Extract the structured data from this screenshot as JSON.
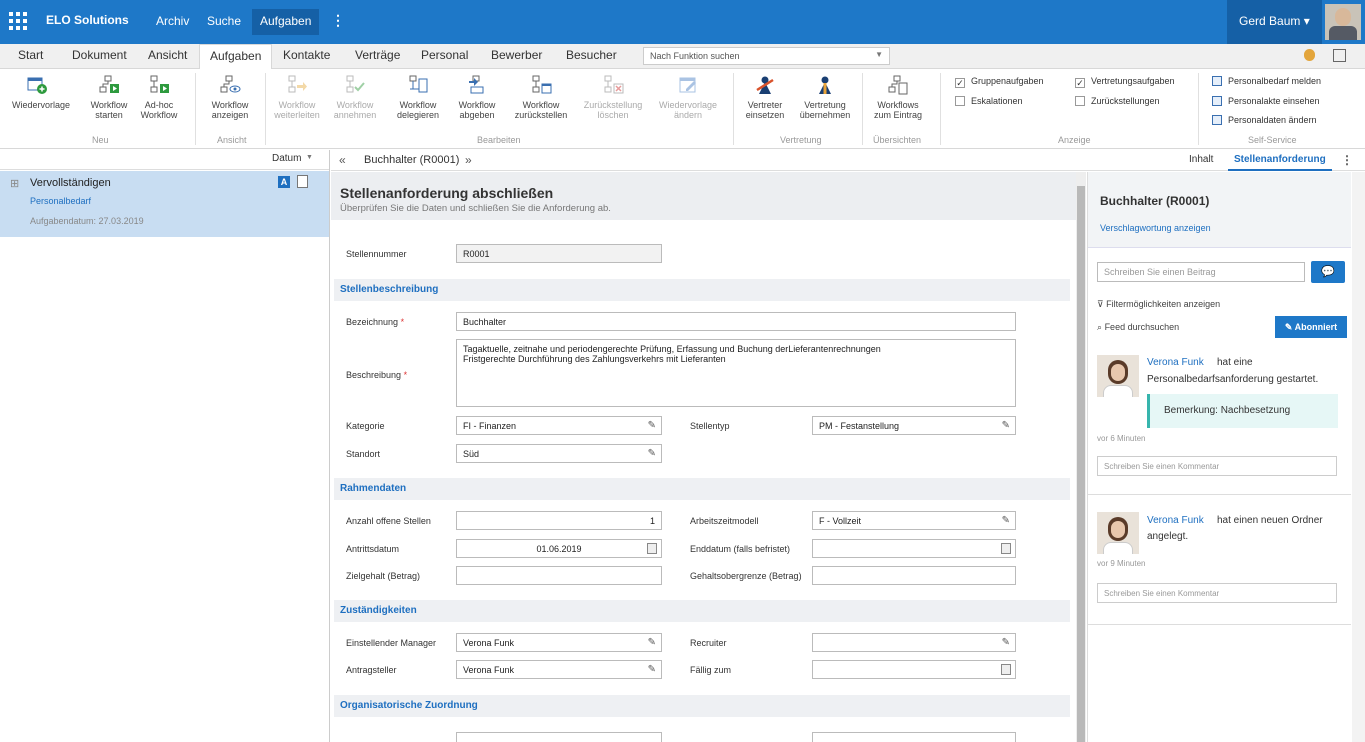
{
  "topbar": {
    "brand": "ELO Solutions",
    "nav": [
      "Archiv",
      "Suche",
      "Aufgaben"
    ],
    "more": "⋮",
    "user": "Gerd Baum ▾"
  },
  "ribbon_tabs": [
    "Start",
    "Dokument",
    "Ansicht",
    "Aufgaben",
    "Kontakte",
    "Verträge",
    "Personal",
    "Bewerber",
    "Besucher"
  ],
  "function_search_placeholder": "Nach Funktion suchen",
  "ribbon": {
    "buttons": [
      {
        "label": "Wiedervorlage",
        "icon": "wiedervorlage-icon"
      },
      {
        "label": "Workflow\nstarten",
        "icon": "workflow-start-icon"
      },
      {
        "label": "Ad-hoc\nWorkflow",
        "icon": "adhoc-workflow-icon"
      },
      {
        "label": "Workflow\nanzeigen",
        "icon": "workflow-view-icon"
      },
      {
        "label": "Workflow\nweiterleiten",
        "icon": "workflow-forward-icon"
      },
      {
        "label": "Workflow\nannehmen",
        "icon": "workflow-accept-icon"
      },
      {
        "label": "Workflow\ndelegieren",
        "icon": "workflow-delegate-icon"
      },
      {
        "label": "Workflow\nabgeben",
        "icon": "workflow-handover-icon"
      },
      {
        "label": "Workflow\nzurückstellen",
        "icon": "workflow-defer-icon"
      },
      {
        "label": "Zurückstellung\nlöschen",
        "icon": "delete-deferral-icon"
      },
      {
        "label": "Wiedervorlage\nändern",
        "icon": "edit-resubmission-icon"
      },
      {
        "label": "Vertreter\neinsetzen",
        "icon": "assign-substitute-icon"
      },
      {
        "label": "Vertretung\nübernehmen",
        "icon": "take-substitution-icon"
      },
      {
        "label": "Workflows\nzum Eintrag",
        "icon": "workflows-entry-icon"
      }
    ],
    "groups": [
      "Neu",
      "Ansicht",
      "Bearbeiten",
      "Vertretung",
      "Übersichten",
      "Anzeige",
      "Self-Service"
    ],
    "checkboxes": [
      {
        "label": "Gruppenaufgaben",
        "checked": true
      },
      {
        "label": "Eskalationen",
        "checked": false
      },
      {
        "label": "Vertretungsaufgaben",
        "checked": true
      },
      {
        "label": "Zurückstellungen",
        "checked": false
      }
    ],
    "self_service": [
      "Personalbedarf melden",
      "Personalakte einsehen",
      "Personaldaten ändern"
    ]
  },
  "left": {
    "sort_label": "Datum",
    "task_title": "Vervollständigen",
    "task_sub": "Personalbedarf",
    "task_date": "Aufgabendatum: 27.03.2019",
    "badge": "A"
  },
  "breadcrumb": {
    "back": "«",
    "title": "Buchhalter (R0001)",
    "forward": "»"
  },
  "view_tabs": [
    "Inhalt",
    "Stellenanforderung"
  ],
  "form": {
    "title": "Stellenanforderung abschließen",
    "subtitle": "Überprüfen Sie die Daten und schließen Sie die Anforderung ab.",
    "stellennummer_label": "Stellennummer",
    "stellennummer": "R0001",
    "sections": [
      "Stellenbeschreibung",
      "Rahmendaten",
      "Zuständigkeiten",
      "Organisatorische Zuordnung"
    ],
    "bezeichnung_label": "Bezeichnung",
    "bezeichnung": "Buchhalter",
    "beschreibung_label": "Beschreibung",
    "beschreibung_line1": "Tagaktuelle, zeitnahe und periodengerechte Prüfung, Erfassung und Buchung derLieferantenrechnungen",
    "beschreibung_line2": "Fristgerechte Durchführung des Zahlungsverkehrs mit Lieferanten",
    "required_mark": "*",
    "kategorie_label": "Kategorie",
    "kategorie": "FI - Finanzen",
    "stellentyp_label": "Stellentyp",
    "stellentyp": "PM - Festanstellung",
    "standort_label": "Standort",
    "standort": "Süd",
    "anzahl_label": "Anzahl offene Stellen",
    "anzahl": "1",
    "arbeitszeit_label": "Arbeitszeitmodell",
    "arbeitszeit": "F - Vollzeit",
    "antritt_label": "Antrittsdatum",
    "antritt": "01.06.2019",
    "enddatum_label": "Enddatum (falls befristet)",
    "zielgehalt_label": "Zielgehalt (Betrag)",
    "gehaltsobergrenze_label": "Gehaltsobergrenze (Betrag)",
    "manager_label": "Einstellender Manager",
    "manager": "Verona Funk",
    "recruiter_label": "Recruiter",
    "antragsteller_label": "Antragsteller",
    "antragsteller": "Verona Funk",
    "faellig_label": "Fällig zum"
  },
  "feed": {
    "title": "Buchhalter (R0001)",
    "tags_link": "Verschlagwortung anzeigen",
    "post_placeholder": "Schreiben Sie einen Beitrag",
    "filter_link": "Filtermöglichkeiten anzeigen",
    "search_link": "Feed durchsuchen",
    "subscribe": "Abonniert",
    "comment_placeholder": "Schreiben Sie einen Kommentar",
    "entries": [
      {
        "author": "Verona Funk",
        "text1": "hat eine",
        "text2": "Personalbedarfsanforderung gestartet.",
        "note": "Bemerkung: Nachbesetzung",
        "time": "vor 6 Minuten"
      },
      {
        "author": "Verona Funk",
        "text1": "hat einen neuen Ordner",
        "text2": "angelegt.",
        "time": "vor 9 Minuten"
      }
    ]
  }
}
